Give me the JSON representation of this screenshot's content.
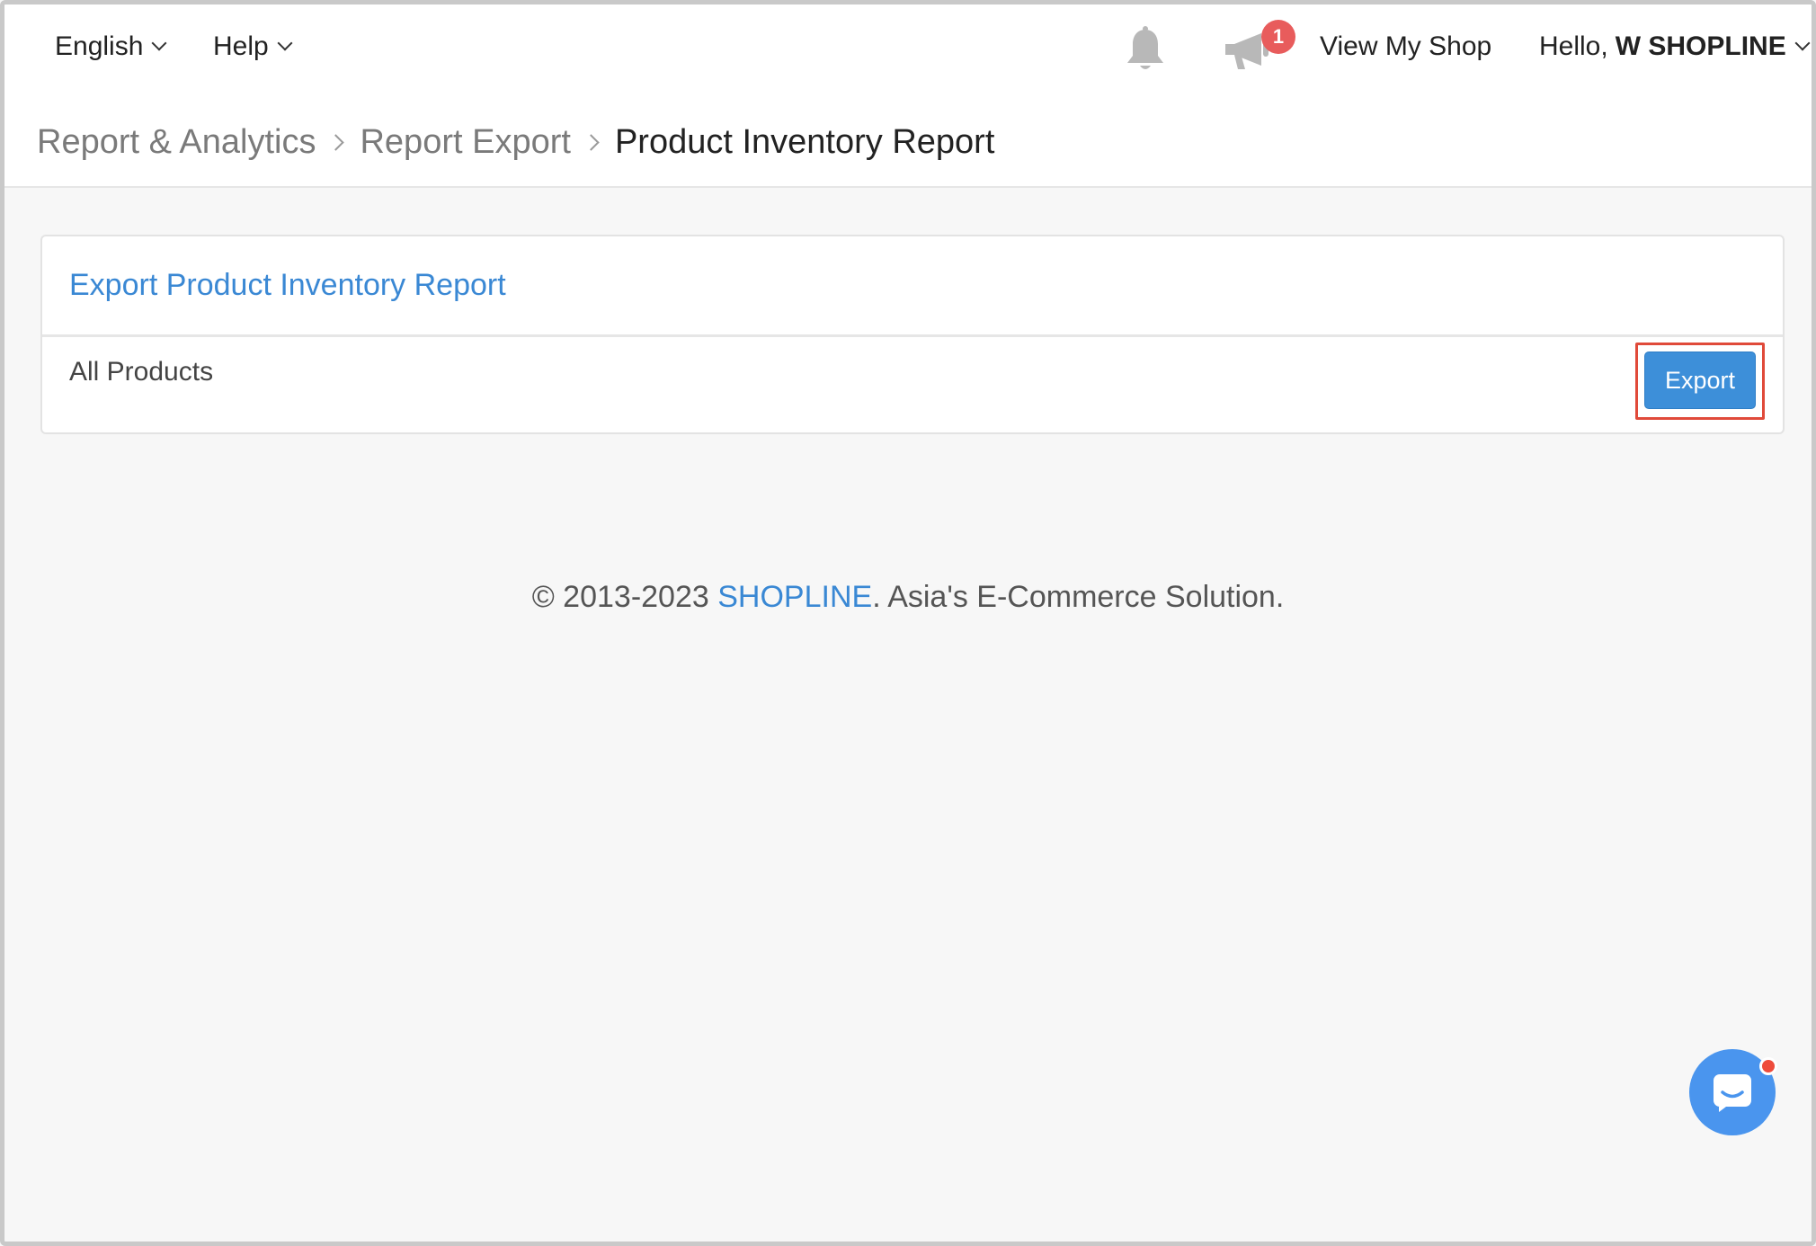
{
  "topbar": {
    "language_label": "English",
    "help_label": "Help",
    "notification_count": "1",
    "view_shop_label": "View My Shop",
    "greeting": "Hello,",
    "user_name": "W SHOPLINE"
  },
  "breadcrumb": {
    "items": [
      "Report & Analytics",
      "Report Export",
      "Product Inventory Report"
    ]
  },
  "panel": {
    "title": "Export Product Inventory Report",
    "row_label": "All Products",
    "export_label": "Export"
  },
  "footer": {
    "prefix": "© 2013-2023 ",
    "brand": "SHOPLINE",
    "suffix": ". Asia's E-Commerce Solution."
  },
  "colors": {
    "accent": "#3a88d4",
    "button": "#3d8fd9",
    "badge": "#e85c5c",
    "highlight": "#e04a3a",
    "chat": "#4a95ee"
  },
  "icons": {
    "bell": "bell-icon",
    "announcement": "megaphone-icon",
    "chat": "chat-bubble-icon"
  }
}
